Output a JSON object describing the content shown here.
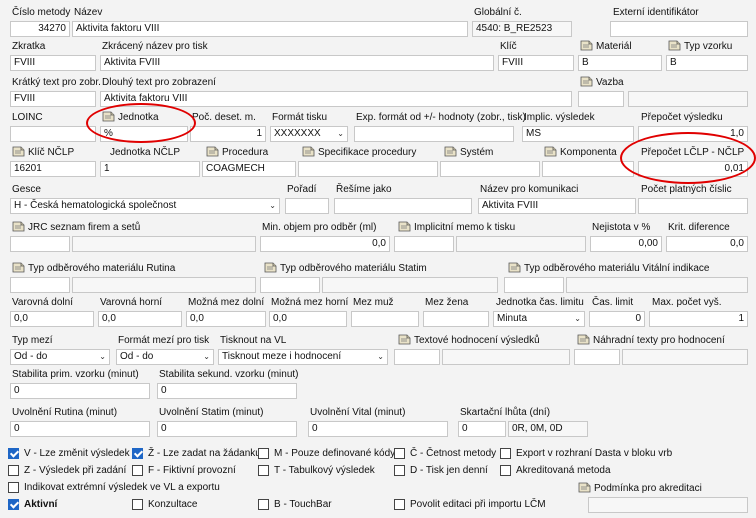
{
  "row1": {
    "cislo_label": "Číslo metody",
    "cislo": "34270",
    "nazev_label": "Název",
    "nazev": "Aktivita faktoru VIII",
    "glob_label": "Globální č.",
    "glob": "4540: B_RE2523",
    "ext_label": "Externí identifikátor",
    "ext": ""
  },
  "row2": {
    "zkr_label": "Zkratka",
    "zkr": "FVIII",
    "zkrnaz_label": "Zkrácený název pro tisk",
    "zkrnaz": "Aktivita FVIII",
    "klic_label": "Klíč",
    "klic": "FVIII",
    "mat_label": "Materiál",
    "mat": "B",
    "typv_label": "Typ vzorku",
    "typv": "B"
  },
  "row3": {
    "kr_label": "Krátký text pro zobr.",
    "kr": "FVIII",
    "dl_label": "Dlouhý text pro zobrazení",
    "dl": "Aktivita faktoru VIII",
    "vazba_label": "Vazba"
  },
  "row4": {
    "loinc_label": "LOINC",
    "loinc": "",
    "jed_label": "Jednotka",
    "jed": "%",
    "poc_label": "Poč. deset. m.",
    "poc": "1",
    "fmt_label": "Formát tisku",
    "fmt": "XXXXXXX",
    "exp_label": "Exp. formát od +/- hodnoty (zobr., tisk)",
    "exp": "",
    "impl_label": "Implic. výsledek",
    "impl": "MS",
    "prep_label": "Přepočet výsledku",
    "prep": "1,0"
  },
  "row5": {
    "klic_label": "Klíč NČLP",
    "klic": "16201",
    "jed_label": "Jednotka NČLP",
    "jed": "1",
    "proc_label": "Procedura",
    "proc": "COAGMECH",
    "spec_label": "Specifikace procedury",
    "sys_label": "Systém",
    "komp_label": "Komponenta",
    "prep_label": "Přepočet LČLP - NČLP",
    "prep": "0,01"
  },
  "row6": {
    "gesce_label": "Gesce",
    "gesce": "H - Česká hematologická společnost",
    "por_label": "Pořadí",
    "res_label": "Řešíme jako",
    "nkom_label": "Název pro komunikaci",
    "nkom": "Aktivita FVIII",
    "pocp_label": "Počet platných číslic"
  },
  "row7": {
    "jrc_label": "JRC seznam firem a setů",
    "minobj_label": "Min. objem pro odběr (ml)",
    "minobj": "0,0",
    "memo_label": "Implicitní memo k tisku",
    "nej_label": "Nejistota v %",
    "nej": "0,00",
    "krit_label": "Krit. diference",
    "krit": "0,0"
  },
  "row8": {
    "rut_label": "Typ odběrového materiálu Rutina",
    "stat_label": "Typ odběrového materiálu Statim",
    "vit_label": "Typ odběrového materiálu Vitální indikace"
  },
  "row9": {
    "vd_label": "Varovná dolní",
    "vd": "0,0",
    "vh_label": "Varovná horní",
    "vh": "0,0",
    "md_label": "Možná mez dolní",
    "md": "0,0",
    "mh_label": "Možná mez horní",
    "mh": "0,0",
    "mm_label": "Mez muž",
    "mz_label": "Mez žena",
    "jcl_label": "Jednotka čas. limitu",
    "jcl": "Minuta",
    "cl_label": "Čas. limit",
    "cl": "0",
    "max_label": "Max. počet vyš.",
    "max": "1"
  },
  "row10": {
    "tm_label": "Typ mezí",
    "tm": "Od - do",
    "fmp_label": "Formát mezí pro tisk",
    "fmp": "Od - do",
    "tvl_label": "Tisknout na VL",
    "tvl": "Tisknout meze i hodnocení",
    "thv_label": "Textové hodnocení výsledků",
    "nth_label": "Náhradní texty pro hodnocení"
  },
  "row11": {
    "spv_label": "Stabilita prim. vzorku (minut)",
    "spv": "0",
    "ssv_label": "Stabilita sekund. vzorku (minut)",
    "ssv": "0"
  },
  "row12": {
    "ur_label": "Uvolnění Rutina (minut)",
    "ur": "0",
    "us_label": "Uvolnění Statim (minut)",
    "us": "0",
    "uv_label": "Uvolnění Vital (minut)",
    "uv": "0",
    "sl_label": "Skartační lhůta (dní)",
    "sl": "0",
    "sl_text": "0R, 0M, 0D"
  },
  "checks": [
    {
      "label": "V - Lze změnit výsledek",
      "on": true
    },
    {
      "label": "Ž - Lze zadat na žádanku",
      "on": true
    },
    {
      "label": "M - Pouze definované kódy",
      "on": false
    },
    {
      "label": "Č - Četnost metody",
      "on": false
    },
    {
      "label": "Export v rozhraní Dasta v bloku vrb",
      "on": false
    },
    {
      "label": "Z - Výsledek při zadání",
      "on": false
    },
    {
      "label": "F - Fiktivní provozní",
      "on": false
    },
    {
      "label": "T - Tabulkový výsledek",
      "on": false
    },
    {
      "label": "D - Tisk jen denní",
      "on": false
    },
    {
      "label": "Akreditovaná metoda",
      "on": false
    },
    {
      "label": "Indikovat extrémní výsledek ve VL a exportu",
      "on": false
    },
    {
      "label": "Aktivní",
      "on": true
    },
    {
      "label": "Konzultace",
      "on": false
    },
    {
      "label": "B - TouchBar",
      "on": false
    },
    {
      "label": "Povolit editaci při importu LČM",
      "on": false
    }
  ],
  "podminka_label": "Podmínka pro akreditaci",
  "colors": {
    "field_border": "#c8c8c8",
    "checkbox_on": "#1e66c6",
    "highlight": "#e00000"
  }
}
